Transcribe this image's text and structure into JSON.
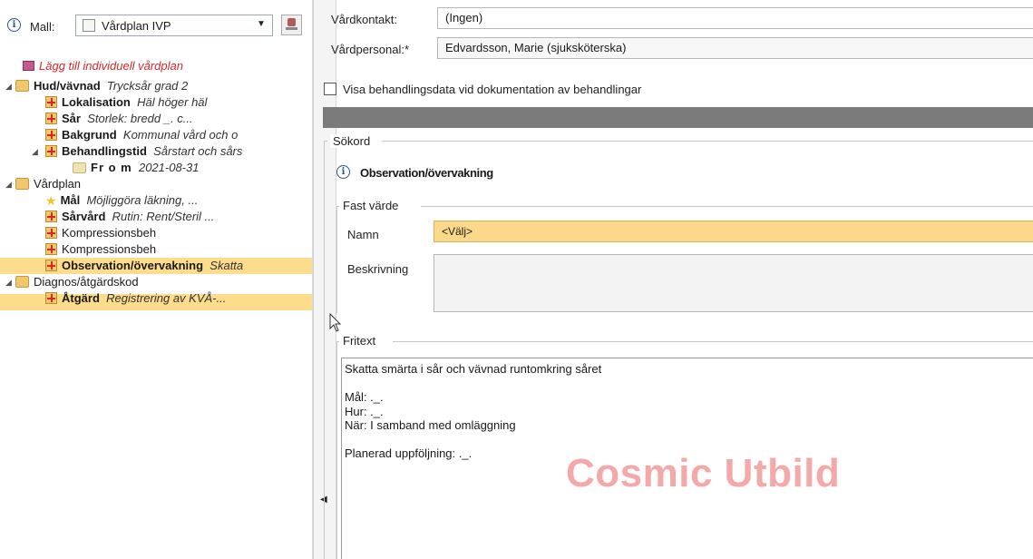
{
  "header": {
    "mall_label": "Mall:",
    "mall_value": "Vårdplan IVP"
  },
  "tree": {
    "add_plan": "Lägg till individuell vårdplan",
    "hud_label": "Hud/vävnad",
    "hud_value": "Trycksår grad 2",
    "lokalisation_label": "Lokalisation",
    "lokalisation_value": "Häl höger häl",
    "sar_label": "Sår",
    "sar_value": "Storlek: bredd _. c...",
    "bakgrund_label": "Bakgrund",
    "bakgrund_value": "Kommunal vård och o",
    "behandlingstid_label": "Behandlingstid",
    "behandlingstid_value": "Sårstart och sårs",
    "from_label": "Fr o m",
    "from_value": "2021-08-31",
    "vardplan_label": "Vårdplan",
    "mal_label": "Mål",
    "mal_value": "Möjliggöra läkning, ...",
    "sarvard_label": "Sårvård",
    "sarvard_value": "Rutin: Rent/Steril ...",
    "kompression1_label": "Kompressionsbeh",
    "kompression2_label": "Kompressionsbeh",
    "observation_label": "Observation/övervakning",
    "observation_value": "Skatta",
    "diagnos_label": "Diagnos/åtgärdskod",
    "atgard_label": "Åtgärd",
    "atgard_value": "Registrering av KVÅ-..."
  },
  "form": {
    "vardkontakt_label": "Vårdkontakt:",
    "vardkontakt_value": "(Ingen)",
    "vardpersonal_label": "Vårdpersonal:*",
    "vardpersonal_value": "Edvardsson, Marie (sjuksköterska)",
    "checkbox_label": "Visa behandlingsdata vid dokumentation av behandlingar",
    "sokord_label": "Sökord",
    "section_title": "Observation/övervakning",
    "fast_varde_label": "Fast värde",
    "namn_label": "Namn",
    "namn_value": "<Välj>",
    "beskrivning_label": "Beskrivning",
    "fritext_label": "Fritext",
    "fritext_lines": [
      "Skatta smärta i sår och vävnad runtomkring såret",
      "",
      "Mål: ._.",
      "Hur: ._.",
      "När: I samband med omläggning",
      "",
      "Planerad uppföljning: ._."
    ]
  },
  "watermark": "Cosmic Utbild",
  "colors": {
    "selection": "#fddc8b",
    "namn_field": "#fcd98a",
    "dark_bar": "#7b7b7b",
    "watermark": "#f28c8c",
    "add_link": "#d7262a"
  }
}
